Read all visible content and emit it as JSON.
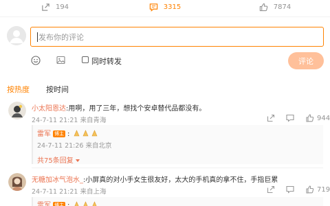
{
  "post_actions": {
    "repost_count": "194",
    "comment_count": "3315",
    "like_count": "7874",
    "accent": "#ff8200"
  },
  "composer": {
    "placeholder": "发布你的评论",
    "repost_label": "同时转发",
    "submit_label": "评论"
  },
  "tabs": {
    "hot": "按热度",
    "time": "按时间"
  },
  "comments": [
    {
      "name": "小太阳恩达",
      "sep": ":",
      "text": "用啊，用了三年，想找个安卓替代品都没有。",
      "meta": "24-7-11 21:21 来自青海",
      "likes": "944",
      "reply": {
        "name": "雷军",
        "badge": "博主",
        "sep": ":",
        "meta": "24-7-11 21:26 来自北京"
      },
      "more_replies": "共75条回复"
    },
    {
      "name": "无糖加冰气泡水_",
      "sep": ":",
      "text": "小屏真的对小手女生很友好，太大的手机真的拿不住，手指巨累",
      "meta": "24-7-11 21:21 来自上海",
      "likes": "719",
      "reply": {
        "name": "雷军",
        "badge": "博主",
        "sep": ":"
      }
    }
  ]
}
